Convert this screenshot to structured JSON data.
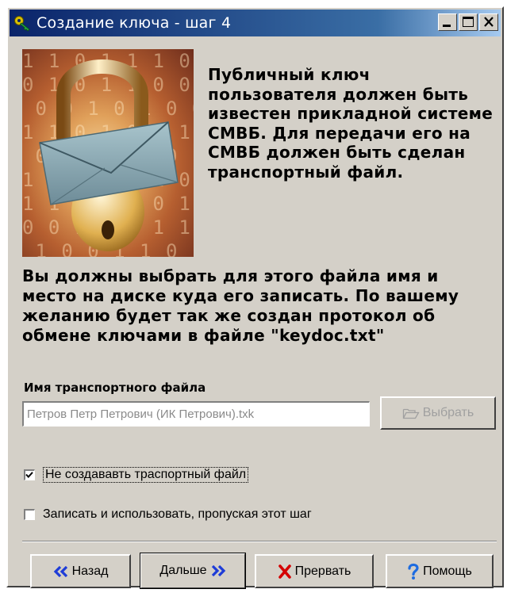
{
  "window": {
    "title": "Создание ключа - шаг 4",
    "title_icon": "key-icon",
    "minimize_icon": "minimize-icon",
    "maximize_icon": "maximize-icon",
    "close_icon": "close-icon"
  },
  "intro_text": "Публичный ключ пользователя должен быть известен прикладной системе СМВБ. Для передачи его на СМВБ должен быть сделан транспортный файл.",
  "instruction_text": "Вы должны выбрать для этого файла имя и место на диске куда его записать. По вашему желанию будет так же создан протокол об обмене ключами в файле \"keydoc.txt\"",
  "file_field": {
    "label": "Имя транспортного файла",
    "value": "Петров Петр Петрович (ИК Петрович).txk",
    "browse_label": "Выбрать",
    "browse_icon": "folder-open-icon",
    "browse_enabled": false
  },
  "options": [
    {
      "label": "Не создававть траспортный файл",
      "checked": true
    },
    {
      "label": "Записать и использовать, пропуская этот шаг",
      "checked": false
    }
  ],
  "buttons": {
    "back": {
      "label": "Назад",
      "icon": "double-chevron-left-icon"
    },
    "next": {
      "label": "Дальше",
      "icon": "double-chevron-right-icon"
    },
    "cancel": {
      "label": "Прервать",
      "icon": "red-x-icon"
    },
    "help": {
      "label": "Помощь",
      "icon": "question-mark-icon"
    }
  },
  "colors": {
    "titlebar_start": "#0a246a",
    "titlebar_end": "#a6caf0",
    "face": "#d4d0c8",
    "chevron_blue": "#1e3cd8",
    "cancel_red": "#d40000"
  }
}
